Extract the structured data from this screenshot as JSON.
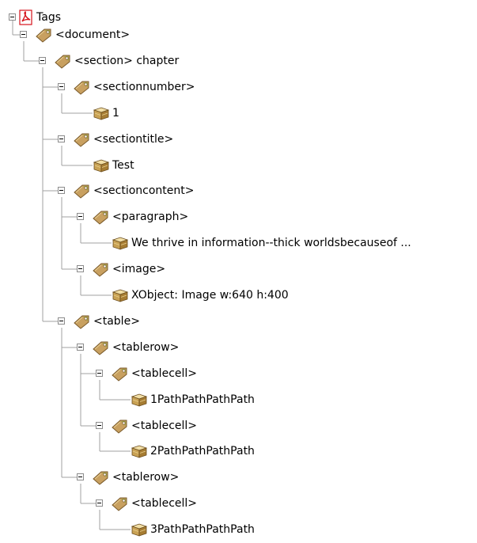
{
  "root": {
    "label": "Tags",
    "icon": "pdf-icon"
  },
  "nodes": [
    {
      "label": "<document>",
      "kind": "tag"
    },
    {
      "label": "<section> chapter",
      "kind": "tag"
    },
    {
      "label": "<sectionnumber>",
      "kind": "tag"
    },
    {
      "label": "1",
      "kind": "content"
    },
    {
      "label": "<sectiontitle>",
      "kind": "tag"
    },
    {
      "label": "Test",
      "kind": "content"
    },
    {
      "label": "<sectioncontent>",
      "kind": "tag"
    },
    {
      "label": "<paragraph>",
      "kind": "tag"
    },
    {
      "label": "We thrive in information--thick worldsbecauseof ...",
      "kind": "content"
    },
    {
      "label": "<image>",
      "kind": "tag"
    },
    {
      "label": "XObject:  Image  w:640 h:400",
      "kind": "content"
    },
    {
      "label": "<table>",
      "kind": "tag"
    },
    {
      "label": "<tablerow>",
      "kind": "tag"
    },
    {
      "label": "<tablecell>",
      "kind": "tag"
    },
    {
      "label": "1PathPathPathPath",
      "kind": "content"
    },
    {
      "label": "<tablecell>",
      "kind": "tag"
    },
    {
      "label": "2PathPathPathPath",
      "kind": "content"
    },
    {
      "label": "<tablerow>",
      "kind": "tag"
    },
    {
      "label": "<tablecell>",
      "kind": "tag"
    },
    {
      "label": "3PathPathPathPath",
      "kind": "content"
    }
  ],
  "colors": {
    "tag_body": "#c8a060",
    "tag_dark": "#7a5a2a",
    "tag_leaf": "#7fae3a",
    "box_body": "#c9a254",
    "box_light": "#f2dfa6",
    "box_edge": "#6b4d1e",
    "pdf_red": "#d6131b",
    "tree_line": "#a0a0a0"
  }
}
